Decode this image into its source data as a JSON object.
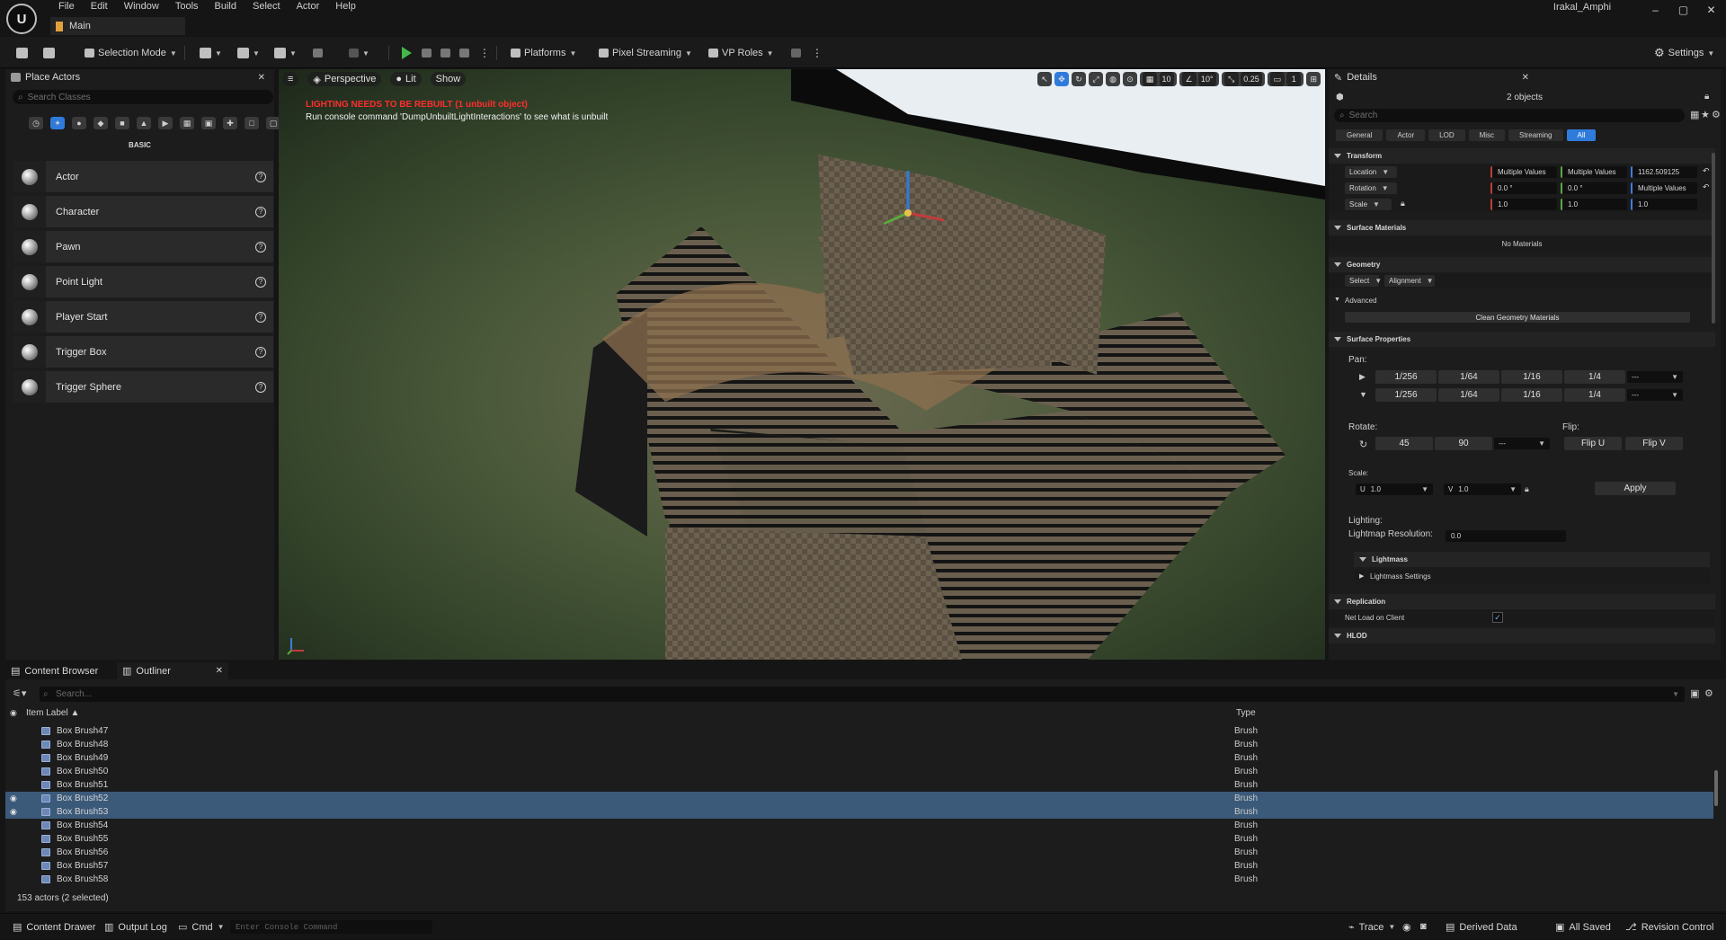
{
  "menu": [
    "File",
    "Edit",
    "Window",
    "Tools",
    "Build",
    "Select",
    "Actor",
    "Help"
  ],
  "tab": {
    "main_label": "Main"
  },
  "project_name": "Irakal_Amphi",
  "window_controls": [
    "–",
    "▢",
    "✕"
  ],
  "toolbar": {
    "mode_label": "Selection Mode",
    "platforms_label": "Platforms",
    "pixel_streaming_label": "Pixel Streaming",
    "vp_roles_label": "VP Roles",
    "settings_label": "Settings"
  },
  "place_actors": {
    "tab_label": "Place Actors",
    "search_placeholder": "Search Classes",
    "category": "BASIC",
    "items": [
      {
        "label": "Actor",
        "icon": "sphere-icon"
      },
      {
        "label": "Character",
        "icon": "character-icon"
      },
      {
        "label": "Pawn",
        "icon": "pawn-icon"
      },
      {
        "label": "Point Light",
        "icon": "lightbulb-icon"
      },
      {
        "label": "Player Start",
        "icon": "flag-icon"
      },
      {
        "label": "Trigger Box",
        "icon": "cube-icon"
      },
      {
        "label": "Trigger Sphere",
        "icon": "sphere-icon"
      }
    ]
  },
  "viewport": {
    "perspective_label": "Perspective",
    "lit_label": "Lit",
    "show_label": "Show",
    "warning": "LIGHTING NEEDS TO BE REBUILT (1 unbuilt object)",
    "console_hint": "Run console command 'DumpUnbuiltLightInteractions' to see what is unbuilt",
    "grid_size": "10",
    "rot_snap": "10°",
    "scale_snap": "0.25",
    "cam_speed": "1"
  },
  "details": {
    "tab_label": "Details",
    "count": "2 objects",
    "search_placeholder": "Search",
    "filters": [
      "General",
      "Actor",
      "LOD",
      "Misc",
      "Streaming",
      "All"
    ],
    "transform": {
      "title": "Transform",
      "location_label": "Location",
      "rotation_label": "Rotation",
      "scale_label": "Scale",
      "location": [
        "Multiple Values",
        "Multiple Values",
        "1162.509125"
      ],
      "rotation": [
        "0.0 °",
        "0.0 °",
        "Multiple Values"
      ],
      "scale": [
        "1.0",
        "1.0",
        "1.0"
      ]
    },
    "surface_materials": {
      "title": "Surface Materials",
      "empty": "No Materials"
    },
    "geometry": {
      "title": "Geometry",
      "select_label": "Select",
      "alignment_label": "Alignment"
    },
    "advanced": {
      "title": "Advanced",
      "clean_button": "Clean Geometry Materials"
    },
    "surface_properties": {
      "title": "Surface Properties",
      "pan_label": "Pan:",
      "pan_values": [
        "1/256",
        "1/64",
        "1/16",
        "1/4"
      ],
      "pan_dropdown": "---",
      "rotate_label": "Rotate:",
      "rotate_values": [
        "45",
        "90"
      ],
      "rotate_dropdown": "---",
      "flip_label": "Flip:",
      "flip_u": "Flip U",
      "flip_v": "Flip V",
      "scale_label": "Scale:",
      "scale_u_label": "U",
      "scale_u": "1.0",
      "scale_v_label": "V",
      "scale_v": "1.0",
      "apply": "Apply",
      "lighting_label": "Lighting:",
      "lightmap_label": "Lightmap Resolution:",
      "lightmap_value": "0.0",
      "lightmass_title": "Lightmass",
      "lightmass_settings": "Lightmass Settings"
    },
    "replication": {
      "title": "Replication",
      "net_load_label": "Net Load on Client"
    },
    "hlod": {
      "title": "HLOD"
    }
  },
  "bottom_tabs": {
    "content_browser": "Content Browser",
    "outliner": "Outliner"
  },
  "outliner": {
    "search_placeholder": "Search...",
    "col_label": "Item Label ▲",
    "col_type": "Type",
    "rows": [
      {
        "name": "Box Brush47",
        "type": "Brush",
        "selected": false
      },
      {
        "name": "Box Brush48",
        "type": "Brush",
        "selected": false
      },
      {
        "name": "Box Brush49",
        "type": "Brush",
        "selected": false
      },
      {
        "name": "Box Brush50",
        "type": "Brush",
        "selected": false
      },
      {
        "name": "Box Brush51",
        "type": "Brush",
        "selected": false
      },
      {
        "name": "Box Brush52",
        "type": "Brush",
        "selected": true
      },
      {
        "name": "Box Brush53",
        "type": "Brush",
        "selected": true
      },
      {
        "name": "Box Brush54",
        "type": "Brush",
        "selected": false
      },
      {
        "name": "Box Brush55",
        "type": "Brush",
        "selected": false
      },
      {
        "name": "Box Brush56",
        "type": "Brush",
        "selected": false
      },
      {
        "name": "Box Brush57",
        "type": "Brush",
        "selected": false
      },
      {
        "name": "Box Brush58",
        "type": "Brush",
        "selected": false
      }
    ],
    "count": "153 actors (2 selected)"
  },
  "status": {
    "content_drawer": "Content Drawer",
    "output_log": "Output Log",
    "cmd": "Cmd",
    "console_placeholder": "Enter Console Command",
    "trace": "Trace",
    "derived_data": "Derived Data",
    "all_saved": "All Saved",
    "revision_control": "Revision Control"
  },
  "colors": {
    "accent": "#2f7bdc",
    "selection": "#3b5a7a",
    "play": "#45b84a",
    "warning": "#ff2d2d"
  }
}
